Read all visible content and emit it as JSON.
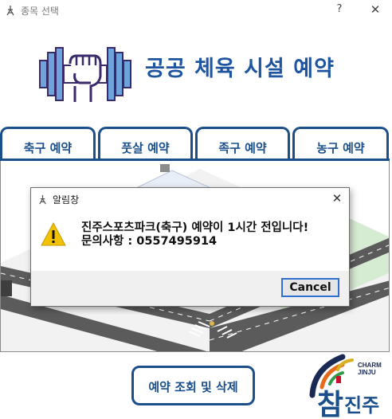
{
  "window": {
    "title": "종목 선택",
    "help_label": "?",
    "close_label": "✕"
  },
  "header": {
    "title": "공공 체육 시설 예약"
  },
  "tabs": [
    {
      "label": "축구 예약"
    },
    {
      "label": "풋살 예약"
    },
    {
      "label": "족구 예약"
    },
    {
      "label": "농구 예약"
    }
  ],
  "dialog": {
    "title": "알림창",
    "close_label": "✕",
    "message_line1": "진주스포츠파크(축구) 예약이 1시간 전입니다!",
    "message_line2": "문의사항 : 0557495914",
    "cancel_label": "Cancel"
  },
  "bottom": {
    "lookup_label": "예약 조회 및 삭제"
  },
  "city_logo": {
    "brand_line1": "CHARM",
    "brand_line2": "JINJU",
    "name_char": "참",
    "name_rest": "진주"
  },
  "colors": {
    "accent": "#1b4f8a",
    "heading": "#1f55a0",
    "warning": "#f2c200",
    "road": "#5b5b5b"
  }
}
